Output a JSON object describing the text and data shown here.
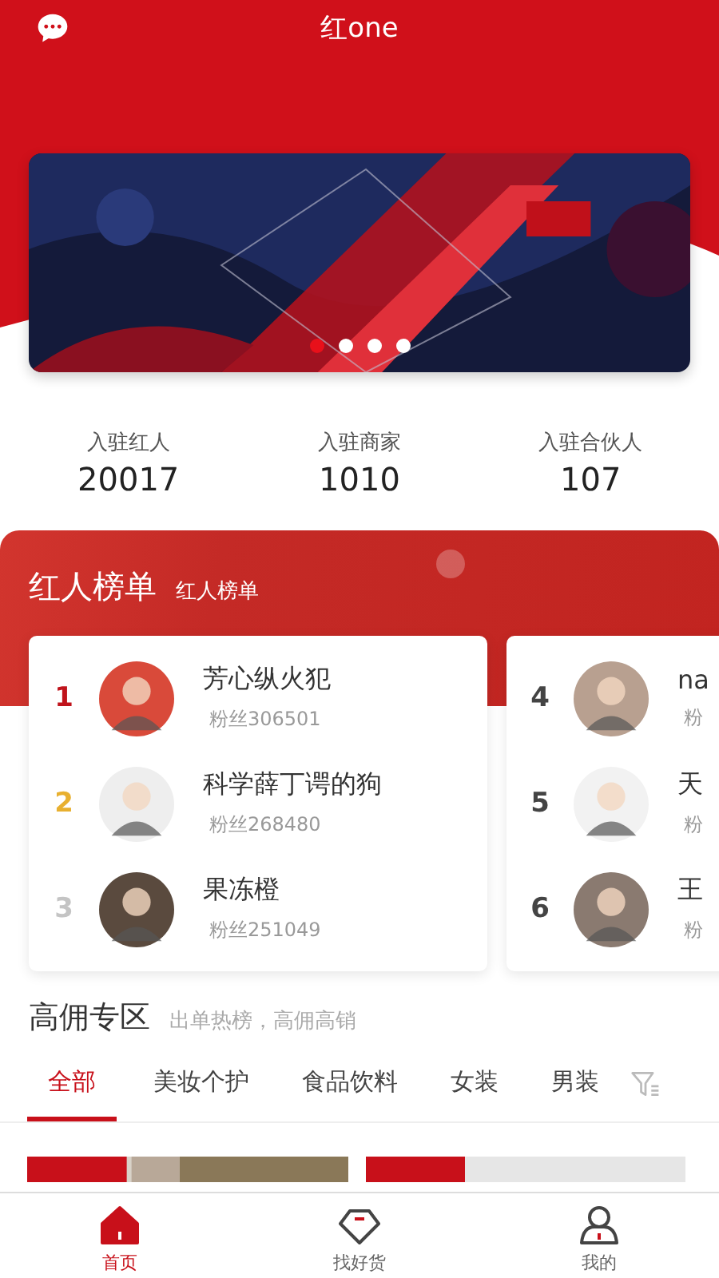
{
  "header": {
    "title": "红one"
  },
  "banner": {
    "kind": "picture",
    "dots": [
      {
        "selected": true
      },
      {
        "selected": false
      },
      {
        "selected": false
      },
      {
        "selected": false
      }
    ]
  },
  "stats": [
    {
      "label": "入驻红人",
      "value": "20017"
    },
    {
      "label": "入驻商家",
      "value": "1010"
    },
    {
      "label": "入驻合伙人",
      "value": "107"
    }
  ],
  "ranking": {
    "title": "红人榜单",
    "subtitle": "红人榜单",
    "cards": [
      {
        "rows": [
          {
            "rank": "1",
            "color": "#c0141c",
            "name": "芳心纵火犯",
            "fans": "粉丝306501"
          },
          {
            "rank": "2",
            "color": "#e8b030",
            "name": "科学薛丁谔的狗",
            "fans": "粉丝268480"
          },
          {
            "rank": "3",
            "color": "#c4c4c4",
            "name": "果冻橙",
            "fans": "粉丝251049"
          }
        ]
      },
      {
        "rows": [
          {
            "rank": "4",
            "color": "#444444",
            "name": "na",
            "fans": "粉"
          },
          {
            "rank": "5",
            "color": "#444444",
            "name": "天",
            "fans": "粉"
          },
          {
            "rank": "6",
            "color": "#444444",
            "name": "王",
            "fans": "粉"
          }
        ]
      }
    ]
  },
  "commission": {
    "title": "高佣专区",
    "subtitle": "出单热榜，高佣高销",
    "tabs": [
      {
        "label": "全部",
        "selected": true
      },
      {
        "label": "美妆个护",
        "selected": false
      },
      {
        "label": "食品饮料",
        "selected": false
      },
      {
        "label": "女装",
        "selected": false
      },
      {
        "label": "男装",
        "selected": false
      }
    ]
  },
  "nav": [
    {
      "label": "首页",
      "selected": true
    },
    {
      "label": "找好货",
      "selected": false
    },
    {
      "label": "我的",
      "selected": false
    }
  ]
}
